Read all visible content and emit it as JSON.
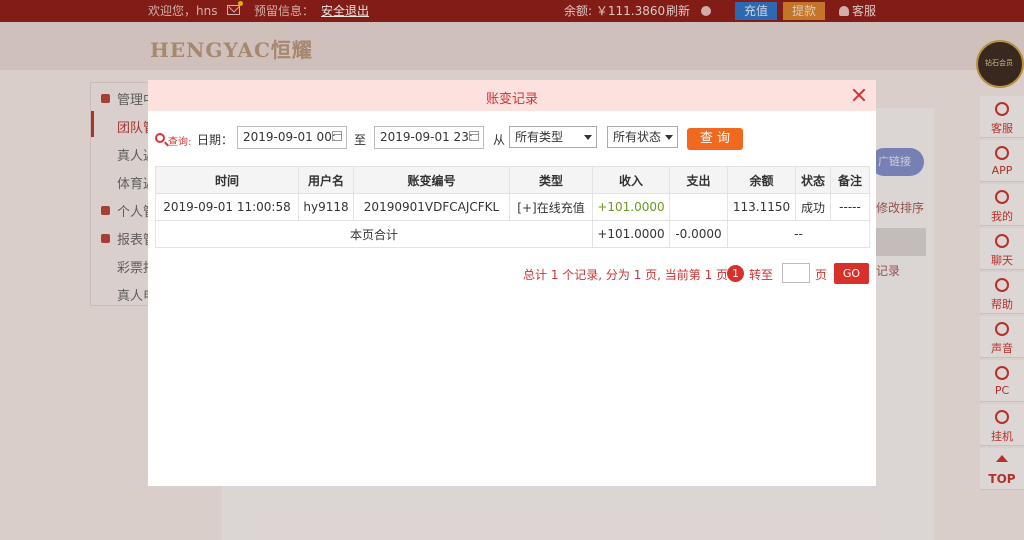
{
  "topbar": {
    "welcome": "欢迎您，hns",
    "notice_label": "预留信息：",
    "logout": "安全退出",
    "balance": "余额: ￥111.3860",
    "refresh": "刷新",
    "recharge": "充值",
    "withdraw": "提款",
    "service": "客服"
  },
  "background": {
    "logo": "HENGYAC恒耀",
    "nav": [
      "管理中",
      "团队管",
      "真人返",
      "体育返",
      "个人管",
      "报表管",
      "彩票报",
      "真人电"
    ],
    "promo_button": "广链接",
    "sort_link": "修改排序",
    "record_link": "记录"
  },
  "rail": {
    "badge": "钻石会员",
    "items": [
      "客服",
      "APP",
      "我的",
      "聊天",
      "帮助",
      "声音",
      "PC",
      "挂机",
      "TOP"
    ]
  },
  "modal": {
    "title": "账变记录",
    "filters": {
      "query_label": "查询:",
      "date_label": "日期：",
      "date_from": "2019-09-01 00:",
      "to_label": "至",
      "date_to": "2019-09-01 23:",
      "from_label": "从",
      "type_select": "所有类型",
      "status_select": "所有状态",
      "query_button": "查 询"
    },
    "table": {
      "headers": [
        "时间",
        "用户名",
        "账变编号",
        "类型",
        "收入",
        "支出",
        "余额",
        "状态",
        "备注"
      ],
      "rows": [
        [
          "2019-09-01 11:00:58",
          "hy9118",
          "20190901VDFCAJCFKL",
          "[+]在线充值",
          "+101.0000",
          "",
          "113.1150",
          "成功",
          "-----"
        ]
      ],
      "summary": {
        "label": "本页合计",
        "income": "+101.0000",
        "expense": "-0.0000",
        "balance": "--"
      }
    },
    "pagination": {
      "summary": "总计 1 个记录, 分为 1 页, 当前第 1 页",
      "current_page": "1",
      "goto_label": "转至",
      "page_unit": "页",
      "go": "GO"
    }
  },
  "colors": {
    "topbar_bg": "#8d1c17",
    "accent_red": "#d9302b",
    "query_orange": "#f0691f",
    "income_green": "#6b9a25"
  }
}
